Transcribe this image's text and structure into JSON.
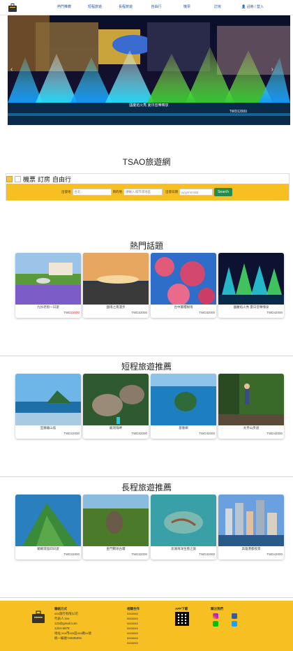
{
  "nav": {
    "links": [
      "熱門推薦",
      "短程旅遊",
      "長程旅遊",
      "自由行",
      "機票",
      "訂房"
    ],
    "member": "👤 註冊 / 登入"
  },
  "hero": {
    "caption": "國慶焰火秀 夏日音樂噴泉",
    "price": "TWD12000"
  },
  "site": {
    "title": "TSAO旅遊網"
  },
  "search": {
    "tabs": [
      "機票",
      "訂房",
      "自由行"
    ],
    "from_label": "出發地",
    "from_placeholder": "台北",
    "to_label": "目的地",
    "to_placeholder": "請輸入城市或地區",
    "date_label": "出發日期",
    "date_placeholder": "yyyy/mm/dd",
    "button": "Search"
  },
  "sections": [
    {
      "title": "熱門話題",
      "cards": [
        {
          "caption": "九份老街一日遊",
          "price_prefix": "TWD",
          "price_value": "22000",
          "price_red": true
        },
        {
          "caption": "國境之南漫步",
          "price_prefix": "TWD",
          "price_value": "32000",
          "price_red": false
        },
        {
          "caption": "台中賞櫻秘境",
          "price_prefix": "TWD",
          "price_value": "32000",
          "price_red": false
        },
        {
          "caption": "國慶焰火秀 夏日音樂噴泉",
          "price_prefix": "TWD",
          "price_value": "42000",
          "price_red": false
        }
      ]
    },
    {
      "title": "短程旅遊推薦",
      "cards": [
        {
          "caption": "宜蘭龜山島",
          "price_prefix": "TWD",
          "price_value": "22000",
          "price_red": false
        },
        {
          "caption": "龍洞灣岬",
          "price_prefix": "TWD",
          "price_value": "32000",
          "price_red": false
        },
        {
          "caption": "基隆嶼",
          "price_prefix": "TWD",
          "price_value": "32000",
          "price_red": false
        },
        {
          "caption": "太平山步道",
          "price_prefix": "TWD",
          "price_value": "42000",
          "price_red": false
        }
      ]
    },
    {
      "title": "長程旅遊推薦",
      "cards": [
        {
          "caption": "蘭嶼環島四日遊",
          "price_prefix": "TWD",
          "price_value": "22000",
          "price_red": false
        },
        {
          "caption": "金門戰地古蹟",
          "price_prefix": "TWD",
          "price_value": "32000",
          "price_red": false
        },
        {
          "caption": "澎湖海洋生態之旅",
          "price_prefix": "TWD",
          "price_value": "32000",
          "price_red": false
        },
        {
          "caption": "高雄港都夜景",
          "price_prefix": "TWD",
          "price_value": "42000",
          "price_red": false
        }
      ]
    }
  ],
  "footer": {
    "contact_head": "聯絡方式",
    "contact": [
      "xxx旅行有限公司",
      "代表人:xxx",
      "123@gmail.com",
      "1234-5678",
      "地址:xxx市xxx區xxx路xx號",
      "統一編號:04635091"
    ],
    "partner_head": "相關合作",
    "partners": [
      "xxxxxxx",
      "xxxxxxx",
      "xxxxxxx",
      "xxxxxxx",
      "xxxxxxx",
      "xxxxxxx",
      "xxxxxxx"
    ],
    "app_head": "APP下載",
    "social_head": "關注我們"
  },
  "colors": {
    "brand": "#f6c022",
    "search_button": "#2a8a4c",
    "link": "#2456a8"
  }
}
